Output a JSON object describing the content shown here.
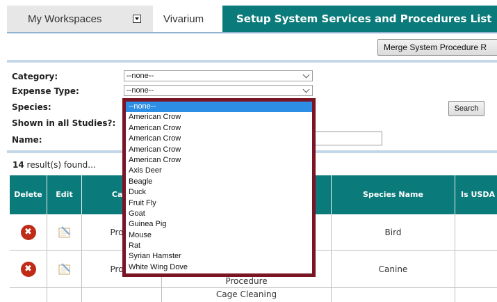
{
  "tabs": {
    "workspaces": "My Workspaces",
    "vivarium": "Vivarium",
    "active": "Setup System Services and Procedures List"
  },
  "toolbar": {
    "merge_label": "Merge System Procedure R"
  },
  "search": {
    "category_label": "Category:",
    "category_value": "--none--",
    "expense_label": "Expense Type:",
    "expense_value": "--none--",
    "species_label": "Species:",
    "shown_label": "Shown in all Studies?:",
    "name_label": "Name:",
    "search_button": "Search"
  },
  "results": {
    "count": "14",
    "suffix": " result(s) found..."
  },
  "table": {
    "headers": [
      "Delete",
      "Edit",
      "Cate",
      "",
      "Species Name",
      "Is USDA S"
    ],
    "rows": [
      {
        "category": "Proce",
        "procedure": "",
        "species": "Bird"
      },
      {
        "category": "Proce",
        "procedure": "Procedure",
        "species": "Canine"
      },
      {
        "category": "",
        "procedure": "Cage Cleaning",
        "species": ""
      }
    ]
  },
  "dropdown": {
    "options": [
      "--none--",
      "American Crow",
      "American Crow",
      "American Crow",
      "American Crow",
      "American Crow",
      "Axis Deer",
      "Beagle",
      "Duck",
      "Fruit Fly",
      "Goat",
      "Guinea Pig",
      "Mouse",
      "Rat",
      "Syrian Hamster",
      "White Wing Dove"
    ],
    "selected_index": 0
  },
  "colors": {
    "accent": "#0b7a7a",
    "delete": "#bf2b17",
    "dropdown_border": "#7a1525",
    "selected": "#2d8ee6"
  }
}
